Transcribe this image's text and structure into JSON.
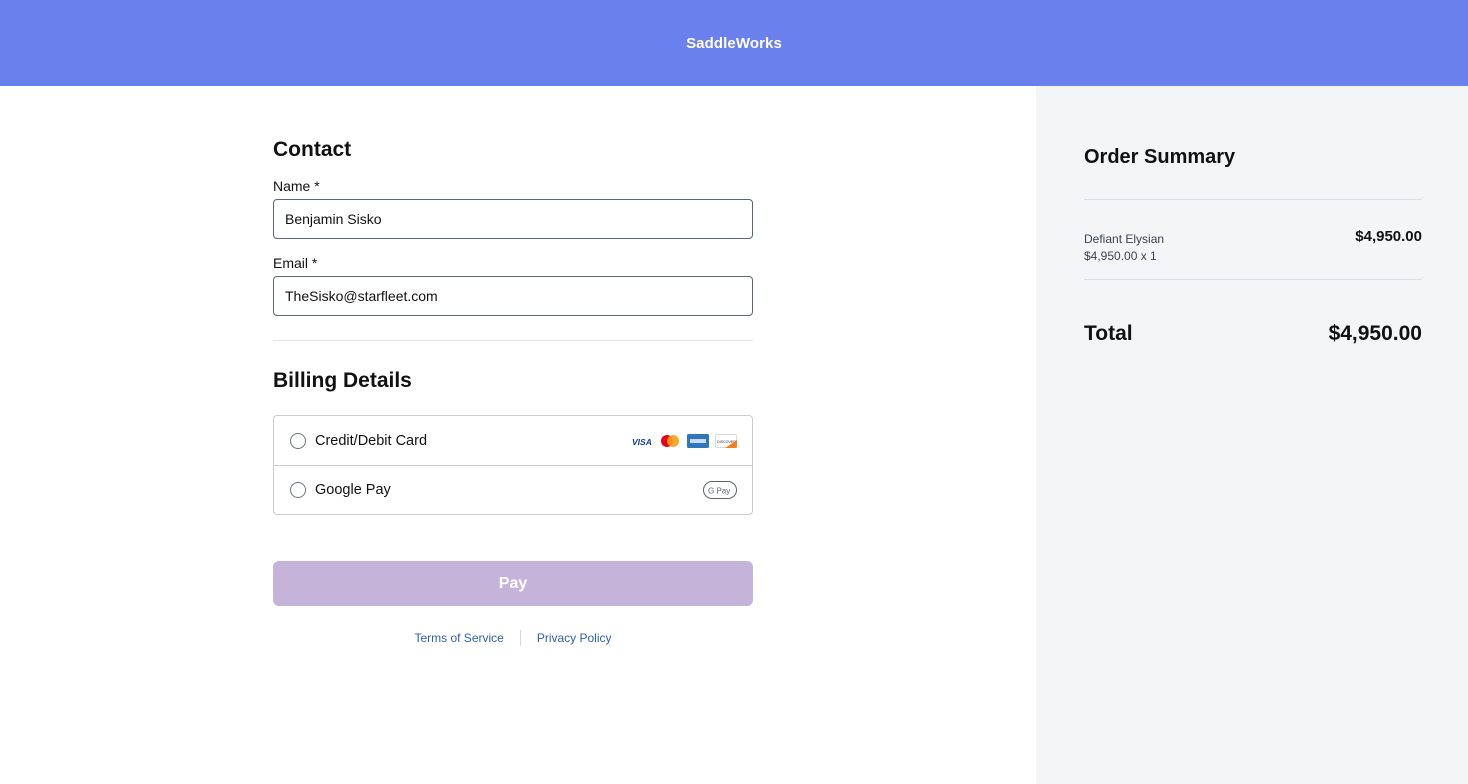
{
  "header": {
    "brand": "SaddleWorks"
  },
  "contact": {
    "title": "Contact",
    "name_label": "Name *",
    "name_value": "Benjamin Sisko",
    "email_label": "Email *",
    "email_value": "TheSisko@starfleet.com"
  },
  "billing": {
    "title": "Billing Details",
    "options": [
      {
        "label": "Credit/Debit Card",
        "icons": [
          "visa-icon",
          "mastercard-icon",
          "amex-icon",
          "discover-icon"
        ]
      },
      {
        "label": "Google Pay",
        "icons": [
          "google-pay-icon"
        ]
      }
    ],
    "card_logo_text": {
      "visa": "VISA",
      "gpay": "G Pay",
      "discover": "DISCOVER"
    }
  },
  "actions": {
    "pay_label": "Pay"
  },
  "footer": {
    "terms": "Terms of Service",
    "privacy": "Privacy Policy"
  },
  "summary": {
    "title": "Order Summary",
    "items": [
      {
        "name": "Defiant Elysian",
        "detail": "$4,950.00 x 1",
        "price": "$4,950.00"
      }
    ],
    "total_label": "Total",
    "total_value": "$4,950.00"
  },
  "colors": {
    "header_bg": "#6a80ec",
    "pay_button_bg": "#c5b3da",
    "sidebar_bg": "#f4f5f7",
    "link": "#2f5fae"
  }
}
